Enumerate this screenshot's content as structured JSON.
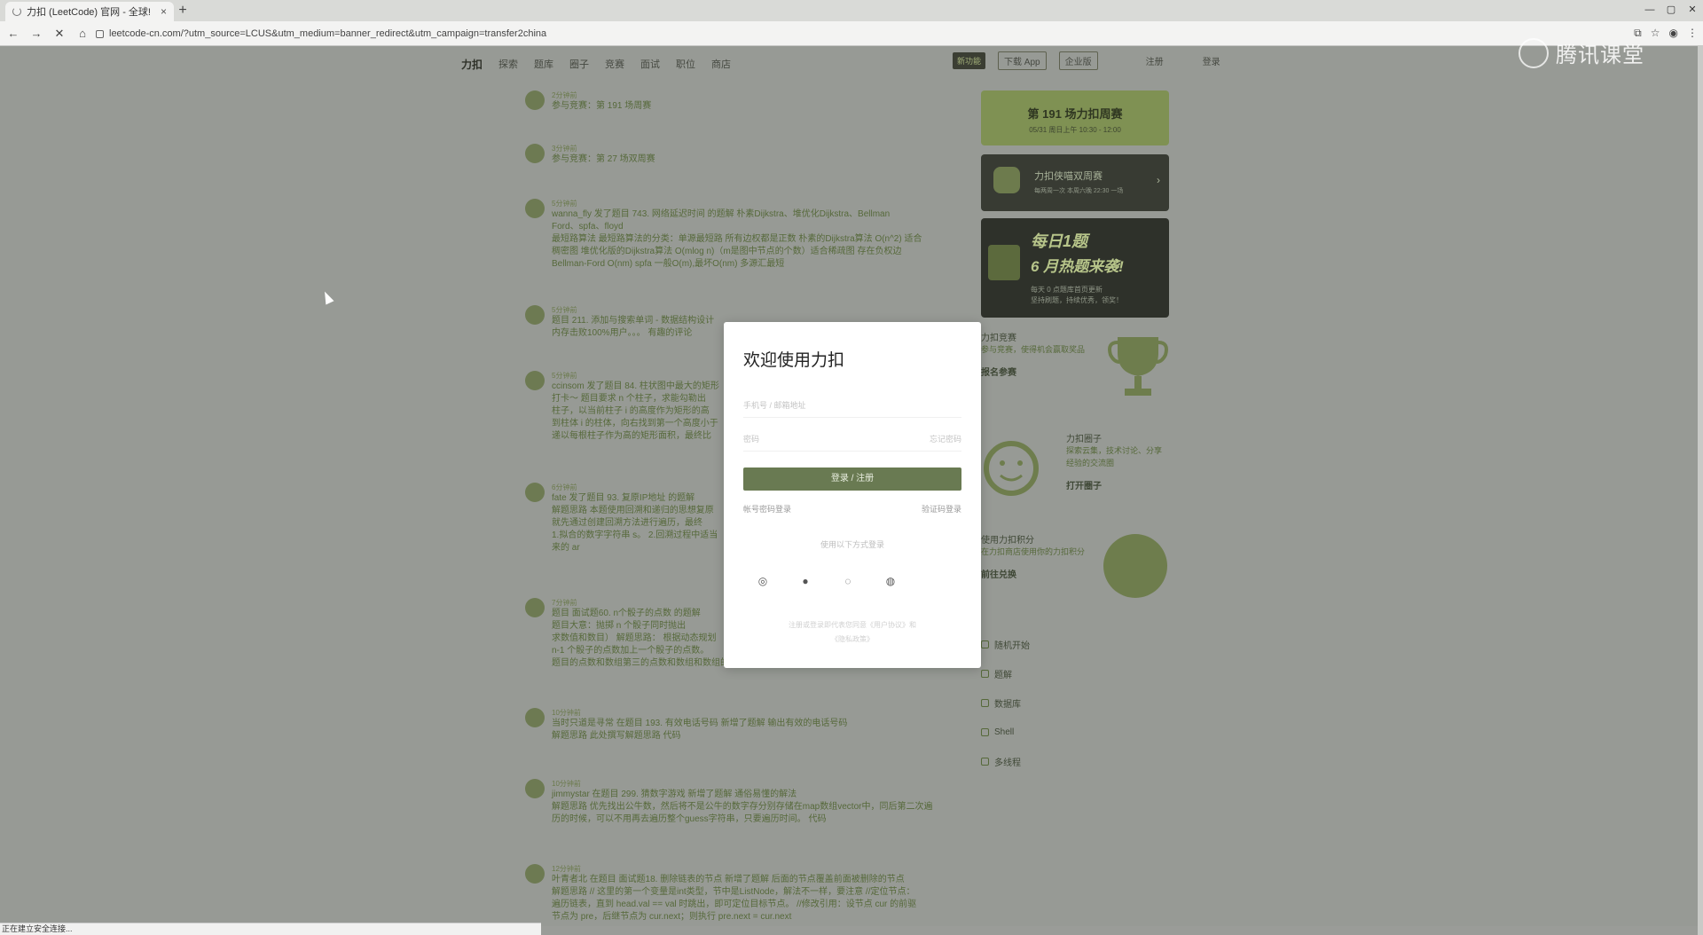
{
  "browser": {
    "tab_title": "力扣 (LeetCode) 官网 - 全球!",
    "tab_close": "×",
    "new_tab": "+",
    "url": "leetcode-cn.com/?utm_source=LCUS&utm_medium=banner_redirect&utm_campaign=transfer2china",
    "window_controls": [
      "—",
      "▢",
      "✕"
    ],
    "nav": {
      "back": "←",
      "forward": "→",
      "reload": "✕",
      "home": "⌂"
    },
    "toolbar_icons": [
      "⧉",
      "☆",
      "◉",
      "⋮"
    ]
  },
  "site": {
    "logo": "力扣",
    "nav_items": [
      "探索",
      "题库",
      "圈子",
      "竞赛",
      "面试",
      "职位",
      "商店"
    ],
    "nav_right": {
      "badge": "新功能",
      "download": "下载 App",
      "enterprise": "企业版",
      "register": "注册",
      "login": "登录"
    }
  },
  "feed": [
    {
      "time": "2分钟前",
      "lines": [
        "参与竞赛：第 191 场周赛"
      ]
    },
    {
      "time": "3分钟前",
      "lines": [
        "参与竞赛：第 27 场双周赛"
      ]
    },
    {
      "time": "5分钟前",
      "lines": [
        "wanna_fly 发了题目 743. 网络延迟时间 的题解 朴素Dijkstra、堆优化Dijkstra、Bellman",
        "Ford、spfa、floyd",
        "最短路算法 最短路算法的分类：单源最短路 所有边权都是正数 朴素的Dijkstra算法 O(n^2) 适合",
        "稠密图 堆优化版的Dijkstra算法 O(mlog n)（m是图中节点的个数）适合稀疏图 存在负权边",
        "Bellman-Ford O(nm) spfa 一般O(m),最坏O(nm) 多源汇最短"
      ]
    },
    {
      "time": "5分钟前",
      "lines": [
        "题目 211. 添加与搜索单词 - 数据结构设计",
        "内存击败100%用户。。。 有趣的评论"
      ]
    },
    {
      "time": "5分钟前",
      "lines": [
        "ccinsom 发了题目 84. 柱状图中最大的矩形",
        "打卡～ 题目要求 n 个柱子，求能勾勒出",
        "柱子，以当前柱子 i 的高度作为矩形的高",
        "到柱体 i 的柱体，向右找到第一个高度小于",
        "递以每根柱子作为高的矩形面积，最终比"
      ]
    },
    {
      "time": "6分钟前",
      "lines": [
        "fate 发了题目 93. 复原IP地址 的题解",
        "解题思路 本题使用回溯和递归的思想复原",
        "就先通过创建回溯方法进行遍历，最终",
        "1.拟合的数字字符串 s。 2.回溯过程中适当",
        "来的 ar"
      ]
    },
    {
      "time": "7分钟前",
      "lines": [
        "题目 面试题60. n个骰子的点数 的题解",
        "题目大意：抛掷 n 个骰子同时抛出",
        "求数值和数目）   解题思路：  根据动态规划",
        "n-1 个骰子的点数加上一个骰子的点数。",
        "题目的点数和数组第三的点数和数组和数组的一组数值"
      ]
    },
    {
      "time": "10分钟前",
      "lines": [
        "当时只道是寻常 在题目 193. 有效电话号码 新增了题解 输出有效的电话号码",
        "解题思路 此处撰写解题思路 代码"
      ]
    },
    {
      "time": "10分钟前",
      "lines": [
        "jimmystar 在题目 299. 猜数字游戏 新增了题解 通俗易懂的解法",
        "解题思路 优先找出公牛数，然后将不是公牛的数字存分别存储在map数组vector中，同后第二次遍",
        "历的时候，可以不用再去遍历整个guess字符串，只要遍历时间。 代码"
      ]
    },
    {
      "time": "12分钟前",
      "lines": [
        "叶青者北 在题目 面试题18. 删除链表的节点 新增了题解 后面的节点覆盖前面被删除的节点",
        "解题思路 // 这里的第一个变量是int类型，节中是ListNode，解法不一样，要注意 //定位节点：",
        "遍历链表，直到 head.val == val 时跳出，即可定位目标节点。 //修改引用：设节点 cur 的前驱",
        "节点为 pre，后继节点为 cur.next；则执行 pre.next = cur.next"
      ]
    }
  ],
  "sidebar": {
    "contest_card": {
      "title": "第 191 场力扣周赛",
      "subtitle": "05/31 周日上午 10:30 - 12:00"
    },
    "biweekly_card": {
      "title": "力扣侠喵双周赛",
      "subtitle": "每两周一次  本周六晚 22:30 一场",
      "chevron": "›"
    },
    "daily_card": {
      "title1": "每日1题",
      "title2": "6 月热题来袭!",
      "subtitle1": "每天 0 点题库首页更新",
      "subtitle2": "坚持刷题，持续优秀，领奖！"
    },
    "contest_block": {
      "heading": "力扣竞赛",
      "desc": "参与竞赛，使得机会赢取奖品",
      "link": "报名参赛"
    },
    "circle_block": {
      "heading": "力扣圈子",
      "desc": "探索云集，技术讨论、分享经验的交流圈",
      "link": "打开圈子"
    },
    "points_block": {
      "heading": "使用力扣积分",
      "desc": "在力扣商店使用你的力扣积分",
      "link": "前往兑换"
    },
    "menu": [
      "随机开始",
      "题解",
      "数据库",
      "Shell",
      "多线程"
    ]
  },
  "modal": {
    "title": "欢迎使用力扣",
    "username_placeholder": "手机号 / 邮箱地址",
    "password_placeholder": "密码",
    "password_right": "忘记密码",
    "login_button": "登录 / 注册",
    "left_link": "帐号密码登录",
    "right_link": "验证码登录",
    "divider": "使用以下方式登录",
    "social": [
      "◎",
      "●",
      "◌",
      "◍"
    ],
    "terms_line1": "注册或登录即代表您同意《用户协议》和",
    "terms_line2": "《隐私政策》"
  },
  "watermark": {
    "text": "腾讯课堂"
  },
  "statusbar": {
    "text": "正在建立安全连接..."
  }
}
